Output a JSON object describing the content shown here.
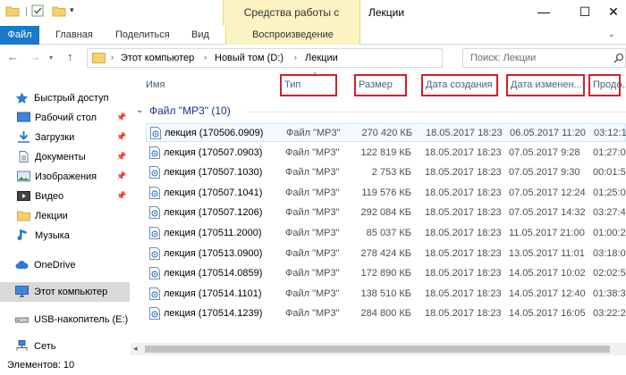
{
  "window": {
    "title": "Лекции",
    "context_tab": "Средства работы с музыкой",
    "minimize": "—",
    "maximize": "☐",
    "close": "✕"
  },
  "ribbon": {
    "tabs": [
      "Файл",
      "Главная",
      "Поделиться",
      "Вид",
      "Воспроизведение"
    ],
    "expand": "⌄"
  },
  "address": {
    "crumbs": [
      "Этот компьютер",
      "Новый том (D:)",
      "Лекции"
    ],
    "search_placeholder": "Поиск: Лекции"
  },
  "sidebar": {
    "items": [
      {
        "label": "Быстрый доступ",
        "icon": "star-icon"
      },
      {
        "label": "Рабочий стол",
        "icon": "desktop-icon",
        "pinned": true
      },
      {
        "label": "Загрузки",
        "icon": "download-icon",
        "pinned": true
      },
      {
        "label": "Документы",
        "icon": "documents-icon",
        "pinned": true
      },
      {
        "label": "Изображения",
        "icon": "pictures-icon",
        "pinned": true
      },
      {
        "label": "Видео",
        "icon": "video-icon",
        "pinned": true
      },
      {
        "label": "Лекции",
        "icon": "folder-icon"
      },
      {
        "label": "Музыка",
        "icon": "music-icon"
      },
      {
        "label": "OneDrive",
        "icon": "cloud-icon"
      },
      {
        "label": "Этот компьютер",
        "icon": "computer-icon",
        "selected": true
      },
      {
        "label": "USB-накопитель (E:)",
        "icon": "usb-drive-icon"
      },
      {
        "label": "Сеть",
        "icon": "network-icon"
      }
    ]
  },
  "columns": {
    "name": "Имя",
    "type": "Тип",
    "size": "Размер",
    "created": "Дата создания",
    "modified": "Дата изменен...",
    "duration": "Продо..."
  },
  "group": {
    "label": "Файл \"MP3\" (10)"
  },
  "files": [
    {
      "name": "лекция (170506.0909)",
      "type": "Файл \"MP3\"",
      "size": "270 420 КБ",
      "created": "18.05.2017 18:23",
      "modified": "06.05.2017 11:20",
      "duration": "03:12:1"
    },
    {
      "name": "лекция (170507.0903)",
      "type": "Файл \"MP3\"",
      "size": "122 819 КБ",
      "created": "18.05.2017 18:23",
      "modified": "07.05.2017 9:28",
      "duration": "01:27:0"
    },
    {
      "name": "лекция (170507.1030)",
      "type": "Файл \"MP3\"",
      "size": "2 753 КБ",
      "created": "18.05.2017 18:23",
      "modified": "07.05.2017 9:30",
      "duration": "00:01:5"
    },
    {
      "name": "лекция (170507.1041)",
      "type": "Файл \"MP3\"",
      "size": "119 576 КБ",
      "created": "18.05.2017 18:23",
      "modified": "07.05.2017 12:24",
      "duration": "01:25:0"
    },
    {
      "name": "лекция (170507.1206)",
      "type": "Файл \"MP3\"",
      "size": "292 084 КБ",
      "created": "18.05.2017 18:23",
      "modified": "07.05.2017 14:32",
      "duration": "03:27:4"
    },
    {
      "name": "лекция (170511.2000)",
      "type": "Файл \"MP3\"",
      "size": "85 037 КБ",
      "created": "18.05.2017 18:23",
      "modified": "11.05.2017 21:00",
      "duration": "01:00:2"
    },
    {
      "name": "лекция (170513.0900)",
      "type": "Файл \"MP3\"",
      "size": "278 424 КБ",
      "created": "18.05.2017 18:23",
      "modified": "13.05.2017 11:01",
      "duration": "03:18:0"
    },
    {
      "name": "лекция (170514.0859)",
      "type": "Файл \"MP3\"",
      "size": "172 890 КБ",
      "created": "18.05.2017 18:23",
      "modified": "14.05.2017 10:02",
      "duration": "02:02:5"
    },
    {
      "name": "лекция (170514.1101)",
      "type": "Файл \"MP3\"",
      "size": "138 510 КБ",
      "created": "18.05.2017 18:23",
      "modified": "14.05.2017 12:40",
      "duration": "01:38:3"
    },
    {
      "name": "лекция (170514.1239)",
      "type": "Файл \"MP3\"",
      "size": "284 800 КБ",
      "created": "18.05.2017 18:23",
      "modified": "14.05.2017 16:05",
      "duration": "03:22:2"
    }
  ],
  "status": {
    "text": "Элементов: 10"
  },
  "colors": {
    "accent": "#1979ca",
    "context_tab": "#fbf3c1",
    "highlight_box": "#d0212a",
    "group_header": "#1e3287"
  }
}
